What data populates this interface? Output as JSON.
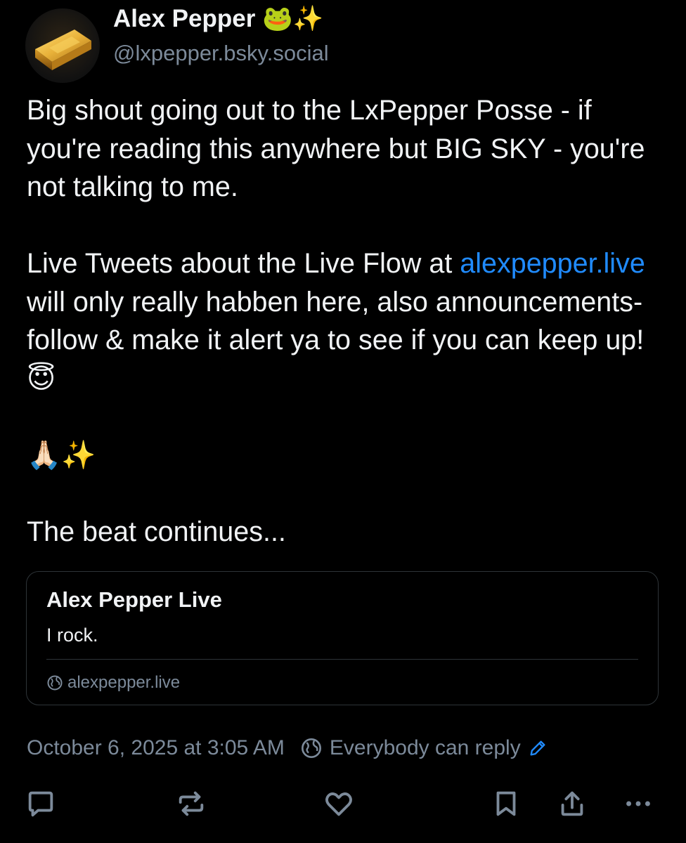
{
  "author": {
    "display_name": "Alex Pepper",
    "name_emojis": "🐸✨",
    "handle": "@lxpepper.bsky.social"
  },
  "post": {
    "paragraph1": "Big shout going out to the LxPepper Posse - if you're reading this anywhere but BIG SKY - you're not talking to me.",
    "paragraph2_before": "Live Tweets about the Live Flow at ",
    "paragraph2_link": "alexpepper.live",
    "paragraph2_after": " will only really habben here, also announcements- follow & make it alert ya to see if you can keep up! ",
    "paragraph2_emoji": "😇",
    "paragraph3": "🙏🏻✨",
    "paragraph4": "The beat continues..."
  },
  "link_card": {
    "title": "Alex Pepper Live",
    "description": "I rock.",
    "domain": "alexpepper.live"
  },
  "meta": {
    "timestamp": "October 6, 2025 at 3:05 AM",
    "reply_setting": "Everybody can reply"
  },
  "actions": {
    "icons": [
      "reply-icon",
      "repost-icon",
      "like-icon",
      "bookmark-icon",
      "share-icon",
      "more-icon"
    ]
  },
  "colors": {
    "background": "#000000",
    "text": "#f1f3f5",
    "muted": "#7c8a9a",
    "link": "#208bfe",
    "border": "#2e3438"
  }
}
